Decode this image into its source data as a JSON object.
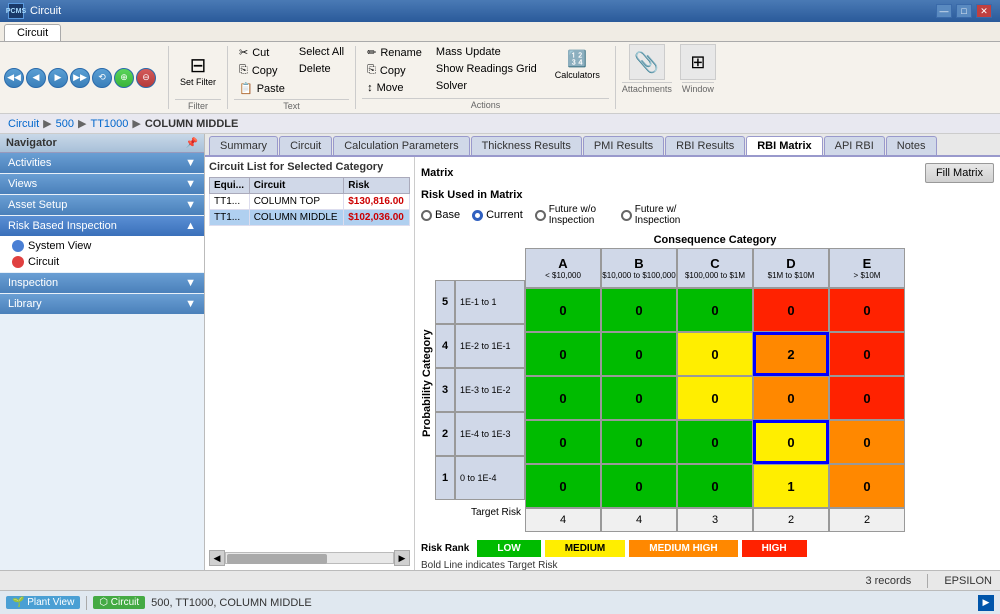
{
  "titleBar": {
    "logo": "PCMS",
    "title": "Circuit",
    "controls": [
      "—",
      "□",
      "✕"
    ]
  },
  "appTab": {
    "label": "Circuit"
  },
  "toolbar": {
    "navButtons": [
      "◀◀",
      "◀",
      "▶",
      "▶▶",
      "⟲",
      "⊕",
      "⊖"
    ],
    "filterBtn": "Set Filter",
    "groups": {
      "text": {
        "label": "Text",
        "items": [
          "Cut",
          "Copy",
          "Paste",
          "Select All",
          "Delete"
        ]
      },
      "actions": {
        "label": "Actions",
        "items": [
          "Rename",
          "Copy",
          "Move",
          "Mass Update",
          "Show Readings Grid",
          "Solver",
          "Calculators"
        ]
      },
      "attachments": {
        "label": "Attachments"
      },
      "window": {
        "label": "Window"
      }
    }
  },
  "breadcrumb": {
    "items": [
      "Circuit",
      "500",
      "TT1000",
      "COLUMN MIDDLE"
    ]
  },
  "navigator": {
    "title": "Navigator",
    "sections": [
      {
        "id": "activities",
        "label": "Activities",
        "expanded": false,
        "items": []
      },
      {
        "id": "views",
        "label": "Views",
        "expanded": false,
        "items": []
      },
      {
        "id": "assetSetup",
        "label": "Asset Setup",
        "expanded": false,
        "items": []
      },
      {
        "id": "riskBasedInspection",
        "label": "Risk Based Inspection",
        "expanded": true,
        "items": [
          {
            "label": "System View",
            "icon": "blue"
          },
          {
            "label": "Circuit",
            "icon": "red"
          }
        ]
      },
      {
        "id": "inspection",
        "label": "Inspection",
        "expanded": false,
        "items": []
      },
      {
        "id": "library",
        "label": "Library",
        "expanded": false,
        "items": []
      }
    ]
  },
  "tabs": [
    {
      "id": "summary",
      "label": "Summary"
    },
    {
      "id": "circuit",
      "label": "Circuit"
    },
    {
      "id": "calcParams",
      "label": "Calculation Parameters"
    },
    {
      "id": "thickness",
      "label": "Thickness Results"
    },
    {
      "id": "pmiResults",
      "label": "PMI Results"
    },
    {
      "id": "rbiResults",
      "label": "RBI Results"
    },
    {
      "id": "rbiMatrix",
      "label": "RBI Matrix",
      "active": true
    },
    {
      "id": "apiRbi",
      "label": "API RBI"
    },
    {
      "id": "notes",
      "label": "Notes"
    }
  ],
  "circuitList": {
    "title": "Circuit List for Selected Category",
    "columns": [
      "Equi...",
      "Circuit",
      "Risk"
    ],
    "rows": [
      {
        "equip": "TT1...",
        "circuit": "COLUMN TOP",
        "risk": "$130,816.00",
        "selected": false
      },
      {
        "equip": "TT1...",
        "circuit": "COLUMN MIDDLE",
        "risk": "$102,036.00",
        "selected": true
      }
    ]
  },
  "matrix": {
    "title": "Matrix",
    "fillMatrixBtn": "Fill Matrix",
    "riskLabel": "Risk Used in Matrix",
    "radioOptions": [
      {
        "id": "base",
        "label": "Base",
        "checked": false
      },
      {
        "id": "current",
        "label": "Current",
        "checked": true
      },
      {
        "id": "futureWo",
        "label": "Future w/o Inspection",
        "checked": false
      },
      {
        "id": "futureW",
        "label": "Future w/ Inspection",
        "checked": false
      }
    ],
    "consequenceTitle": "Consequence Category",
    "columns": [
      {
        "letter": "A",
        "range": "< $10,000"
      },
      {
        "letter": "B",
        "range": "$10,000 to $100,000"
      },
      {
        "letter": "C",
        "range": "$100,000 to $1M"
      },
      {
        "letter": "D",
        "range": "$1M to $10M"
      },
      {
        "letter": "E",
        "range": "> $10M"
      }
    ],
    "probabilityLabel": "Probability Category",
    "rows": [
      {
        "num": "5",
        "range": "1E-1 to 1",
        "cells": [
          {
            "value": "0",
            "color": "green"
          },
          {
            "value": "0",
            "color": "green"
          },
          {
            "value": "0",
            "color": "green"
          },
          {
            "value": "0",
            "color": "red"
          },
          {
            "value": "0",
            "color": "red"
          }
        ]
      },
      {
        "num": "4",
        "range": "1E-2 to 1E-1",
        "cells": [
          {
            "value": "0",
            "color": "green"
          },
          {
            "value": "0",
            "color": "green"
          },
          {
            "value": "0",
            "color": "yellow"
          },
          {
            "value": "2",
            "color": "orange",
            "blueBorder": true
          },
          {
            "value": "0",
            "color": "red"
          }
        ]
      },
      {
        "num": "3",
        "range": "1E-3 to 1E-2",
        "cells": [
          {
            "value": "0",
            "color": "green"
          },
          {
            "value": "0",
            "color": "green"
          },
          {
            "value": "0",
            "color": "yellow"
          },
          {
            "value": "0",
            "color": "orange"
          },
          {
            "value": "0",
            "color": "red"
          }
        ]
      },
      {
        "num": "2",
        "range": "1E-4 to 1E-3",
        "cells": [
          {
            "value": "0",
            "color": "green"
          },
          {
            "value": "0",
            "color": "green"
          },
          {
            "value": "0",
            "color": "green"
          },
          {
            "value": "0",
            "color": "yellow",
            "blueBorder": true
          },
          {
            "value": "0",
            "color": "orange"
          }
        ]
      },
      {
        "num": "1",
        "range": "0 to 1E-4",
        "cells": [
          {
            "value": "0",
            "color": "green"
          },
          {
            "value": "0",
            "color": "green"
          },
          {
            "value": "0",
            "color": "green"
          },
          {
            "value": "1",
            "color": "yellow"
          },
          {
            "value": "0",
            "color": "orange"
          }
        ]
      }
    ],
    "targetRisk": {
      "label": "Target Risk",
      "values": [
        "4",
        "4",
        "3",
        "2",
        "2"
      ]
    },
    "riskRank": {
      "label": "Risk Rank",
      "items": [
        {
          "label": "LOW",
          "color": "green"
        },
        {
          "label": "MEDIUM",
          "color": "yellow"
        },
        {
          "label": "MEDIUM HIGH",
          "color": "orange"
        },
        {
          "label": "HIGH",
          "color": "red"
        }
      ]
    },
    "boldLineNote": "Bold Line indicates Target Risk"
  },
  "statusBar": {
    "records": "3 records",
    "epsilon": "EPSILON"
  },
  "bottomBar": {
    "plantViewTag": "Plant View",
    "circuitTag": "Circuit",
    "circuitLabel": "500, TT1000, COLUMN MIDDLE"
  }
}
